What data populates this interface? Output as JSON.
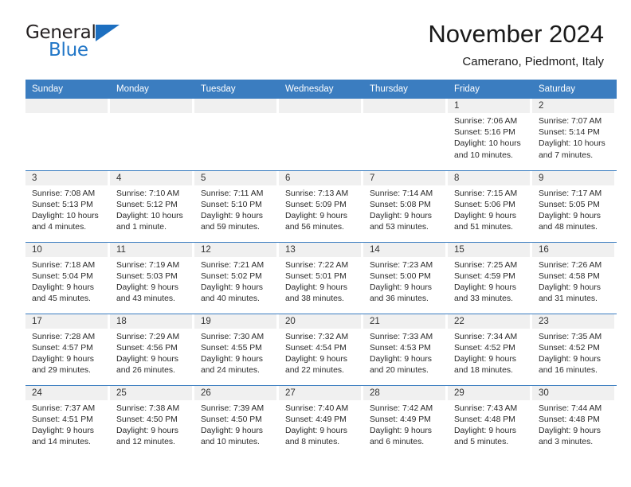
{
  "brand": {
    "name_part1": "General",
    "name_part2": "Blue",
    "accent_color": "#1d6fc0"
  },
  "header": {
    "title": "November 2024",
    "location": "Camerano, Piedmont, Italy",
    "header_bg": "#3b7dc0"
  },
  "weekdays": [
    "Sunday",
    "Monday",
    "Tuesday",
    "Wednesday",
    "Thursday",
    "Friday",
    "Saturday"
  ],
  "weeks": [
    [
      {
        "day": "",
        "blank": true
      },
      {
        "day": "",
        "blank": true
      },
      {
        "day": "",
        "blank": true
      },
      {
        "day": "",
        "blank": true
      },
      {
        "day": "",
        "blank": true
      },
      {
        "day": "1",
        "sunrise": "Sunrise: 7:06 AM",
        "sunset": "Sunset: 5:16 PM",
        "daylight1": "Daylight: 10 hours",
        "daylight2": "and 10 minutes."
      },
      {
        "day": "2",
        "sunrise": "Sunrise: 7:07 AM",
        "sunset": "Sunset: 5:14 PM",
        "daylight1": "Daylight: 10 hours",
        "daylight2": "and 7 minutes."
      }
    ],
    [
      {
        "day": "3",
        "sunrise": "Sunrise: 7:08 AM",
        "sunset": "Sunset: 5:13 PM",
        "daylight1": "Daylight: 10 hours",
        "daylight2": "and 4 minutes."
      },
      {
        "day": "4",
        "sunrise": "Sunrise: 7:10 AM",
        "sunset": "Sunset: 5:12 PM",
        "daylight1": "Daylight: 10 hours",
        "daylight2": "and 1 minute."
      },
      {
        "day": "5",
        "sunrise": "Sunrise: 7:11 AM",
        "sunset": "Sunset: 5:10 PM",
        "daylight1": "Daylight: 9 hours",
        "daylight2": "and 59 minutes."
      },
      {
        "day": "6",
        "sunrise": "Sunrise: 7:13 AM",
        "sunset": "Sunset: 5:09 PM",
        "daylight1": "Daylight: 9 hours",
        "daylight2": "and 56 minutes."
      },
      {
        "day": "7",
        "sunrise": "Sunrise: 7:14 AM",
        "sunset": "Sunset: 5:08 PM",
        "daylight1": "Daylight: 9 hours",
        "daylight2": "and 53 minutes."
      },
      {
        "day": "8",
        "sunrise": "Sunrise: 7:15 AM",
        "sunset": "Sunset: 5:06 PM",
        "daylight1": "Daylight: 9 hours",
        "daylight2": "and 51 minutes."
      },
      {
        "day": "9",
        "sunrise": "Sunrise: 7:17 AM",
        "sunset": "Sunset: 5:05 PM",
        "daylight1": "Daylight: 9 hours",
        "daylight2": "and 48 minutes."
      }
    ],
    [
      {
        "day": "10",
        "sunrise": "Sunrise: 7:18 AM",
        "sunset": "Sunset: 5:04 PM",
        "daylight1": "Daylight: 9 hours",
        "daylight2": "and 45 minutes."
      },
      {
        "day": "11",
        "sunrise": "Sunrise: 7:19 AM",
        "sunset": "Sunset: 5:03 PM",
        "daylight1": "Daylight: 9 hours",
        "daylight2": "and 43 minutes."
      },
      {
        "day": "12",
        "sunrise": "Sunrise: 7:21 AM",
        "sunset": "Sunset: 5:02 PM",
        "daylight1": "Daylight: 9 hours",
        "daylight2": "and 40 minutes."
      },
      {
        "day": "13",
        "sunrise": "Sunrise: 7:22 AM",
        "sunset": "Sunset: 5:01 PM",
        "daylight1": "Daylight: 9 hours",
        "daylight2": "and 38 minutes."
      },
      {
        "day": "14",
        "sunrise": "Sunrise: 7:23 AM",
        "sunset": "Sunset: 5:00 PM",
        "daylight1": "Daylight: 9 hours",
        "daylight2": "and 36 minutes."
      },
      {
        "day": "15",
        "sunrise": "Sunrise: 7:25 AM",
        "sunset": "Sunset: 4:59 PM",
        "daylight1": "Daylight: 9 hours",
        "daylight2": "and 33 minutes."
      },
      {
        "day": "16",
        "sunrise": "Sunrise: 7:26 AM",
        "sunset": "Sunset: 4:58 PM",
        "daylight1": "Daylight: 9 hours",
        "daylight2": "and 31 minutes."
      }
    ],
    [
      {
        "day": "17",
        "sunrise": "Sunrise: 7:28 AM",
        "sunset": "Sunset: 4:57 PM",
        "daylight1": "Daylight: 9 hours",
        "daylight2": "and 29 minutes."
      },
      {
        "day": "18",
        "sunrise": "Sunrise: 7:29 AM",
        "sunset": "Sunset: 4:56 PM",
        "daylight1": "Daylight: 9 hours",
        "daylight2": "and 26 minutes."
      },
      {
        "day": "19",
        "sunrise": "Sunrise: 7:30 AM",
        "sunset": "Sunset: 4:55 PM",
        "daylight1": "Daylight: 9 hours",
        "daylight2": "and 24 minutes."
      },
      {
        "day": "20",
        "sunrise": "Sunrise: 7:32 AM",
        "sunset": "Sunset: 4:54 PM",
        "daylight1": "Daylight: 9 hours",
        "daylight2": "and 22 minutes."
      },
      {
        "day": "21",
        "sunrise": "Sunrise: 7:33 AM",
        "sunset": "Sunset: 4:53 PM",
        "daylight1": "Daylight: 9 hours",
        "daylight2": "and 20 minutes."
      },
      {
        "day": "22",
        "sunrise": "Sunrise: 7:34 AM",
        "sunset": "Sunset: 4:52 PM",
        "daylight1": "Daylight: 9 hours",
        "daylight2": "and 18 minutes."
      },
      {
        "day": "23",
        "sunrise": "Sunrise: 7:35 AM",
        "sunset": "Sunset: 4:52 PM",
        "daylight1": "Daylight: 9 hours",
        "daylight2": "and 16 minutes."
      }
    ],
    [
      {
        "day": "24",
        "sunrise": "Sunrise: 7:37 AM",
        "sunset": "Sunset: 4:51 PM",
        "daylight1": "Daylight: 9 hours",
        "daylight2": "and 14 minutes."
      },
      {
        "day": "25",
        "sunrise": "Sunrise: 7:38 AM",
        "sunset": "Sunset: 4:50 PM",
        "daylight1": "Daylight: 9 hours",
        "daylight2": "and 12 minutes."
      },
      {
        "day": "26",
        "sunrise": "Sunrise: 7:39 AM",
        "sunset": "Sunset: 4:50 PM",
        "daylight1": "Daylight: 9 hours",
        "daylight2": "and 10 minutes."
      },
      {
        "day": "27",
        "sunrise": "Sunrise: 7:40 AM",
        "sunset": "Sunset: 4:49 PM",
        "daylight1": "Daylight: 9 hours",
        "daylight2": "and 8 minutes."
      },
      {
        "day": "28",
        "sunrise": "Sunrise: 7:42 AM",
        "sunset": "Sunset: 4:49 PM",
        "daylight1": "Daylight: 9 hours",
        "daylight2": "and 6 minutes."
      },
      {
        "day": "29",
        "sunrise": "Sunrise: 7:43 AM",
        "sunset": "Sunset: 4:48 PM",
        "daylight1": "Daylight: 9 hours",
        "daylight2": "and 5 minutes."
      },
      {
        "day": "30",
        "sunrise": "Sunrise: 7:44 AM",
        "sunset": "Sunset: 4:48 PM",
        "daylight1": "Daylight: 9 hours",
        "daylight2": "and 3 minutes."
      }
    ]
  ]
}
